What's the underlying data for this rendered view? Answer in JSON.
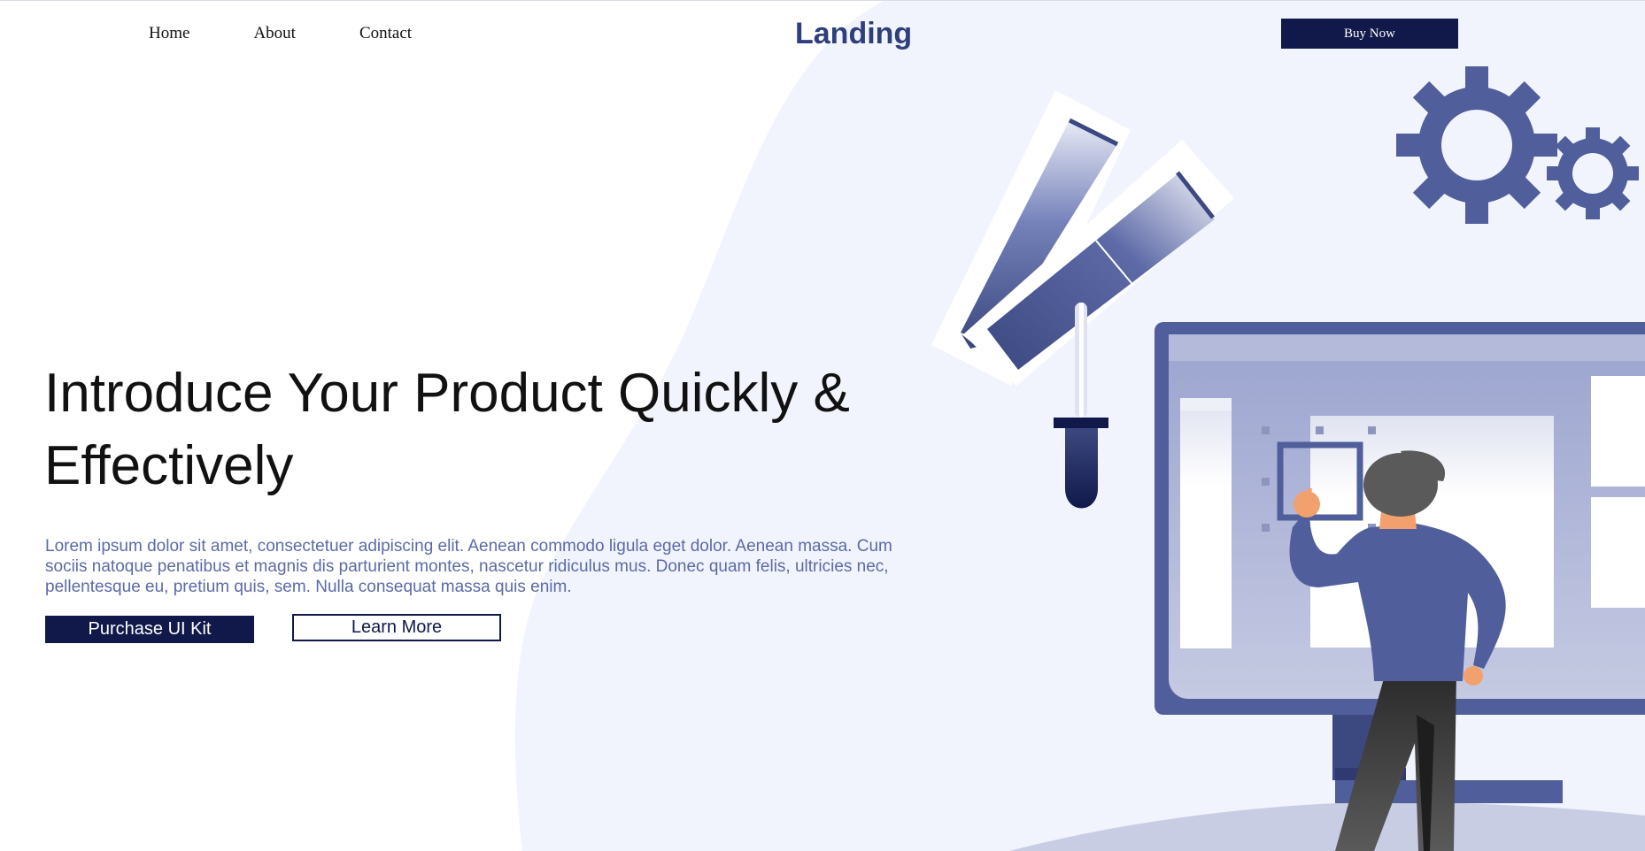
{
  "nav": {
    "items": [
      {
        "label": "Home"
      },
      {
        "label": "About"
      },
      {
        "label": "Contact"
      }
    ]
  },
  "brand": {
    "name": "Landing"
  },
  "header": {
    "buy_label": "Buy Now"
  },
  "hero": {
    "title_line1": "Introduce Your Product Quickly &",
    "title_line2": "Effectively",
    "body": "Lorem ipsum dolor sit amet, consectetuer adipiscing elit. Aenean commodo ligula eget dolor. Aenean massa. Cum sociis natoque penatibus et magnis dis parturient montes, nascetur ridiculus mus. Donec quam felis, ultricies nec, pellentesque eu, pretium quis, sem. Nulla consequat massa quis enim.",
    "primary_label": "Purchase UI Kit",
    "secondary_label": "Learn More"
  },
  "colors": {
    "navy": "#10194a",
    "brand": "#2f3e7d",
    "accent": "#505e9b",
    "blob": "#f1f4fd",
    "body_text": "#5c6aa6"
  },
  "illustration": {
    "icons": [
      "gear-icon",
      "color-swatch-icon",
      "eyedropper-icon",
      "monitor-icon",
      "designer-figure"
    ]
  }
}
